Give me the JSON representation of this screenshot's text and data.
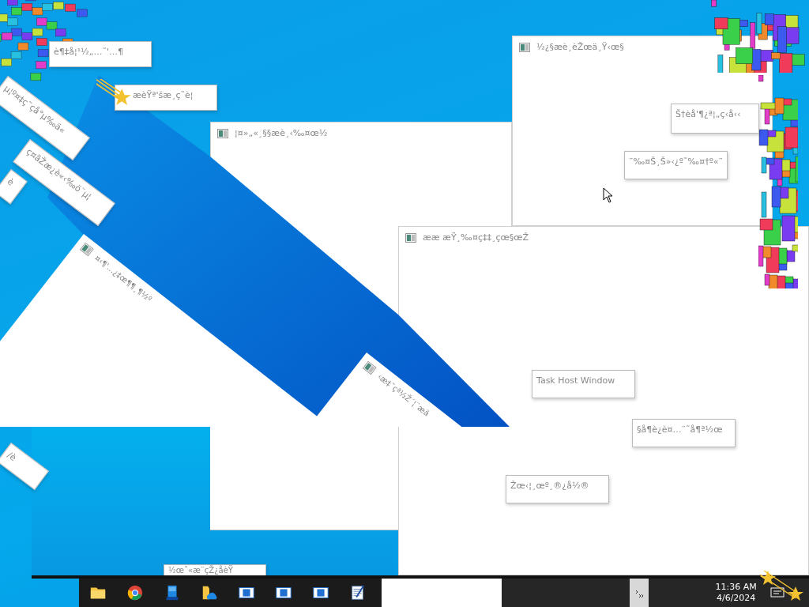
{
  "windows": [
    {
      "title": "¦¤»„«¸§§æè¸‹‰¤œ½"
    },
    {
      "title": "½¿§æè¸èŽœä¸Ÿ‹œ§"
    },
    {
      "title": "ææ æŸ¸‰¤ç‡‡¸çœ§œŽ"
    },
    {
      "title": "¤‹¶'…¿‡œ¶¶¸¶½º"
    },
    {
      "title": "‹æ‡˜çª½Ž´¦¨æä"
    }
  ],
  "floating_labels": [
    {
      "text": "è¶‡å¦¹½„…˜'…¶"
    },
    {
      "text": "æèŸª'šæ¸ç˜è¦"
    },
    {
      "text": "µ¦º¤‡ç˜çå°µ‰ä«"
    },
    {
      "text": "ç¤ãŽæ¿è«‹‰ö¨µ¦"
    },
    {
      "text": "è"
    },
    {
      "text": "Š†èå'¶¿ª¦„ç‹å‹‹"
    },
    {
      "text": "¨‰¤Š¸Š»‹¿º˜‰¤†º«¨"
    },
    {
      "text": "Task Host Window"
    },
    {
      "text": "§å¶è¿è¤…¨˜å¶ª½œ"
    },
    {
      "text": "Žœ‹¦¸œº¸®¿å½®"
    },
    {
      "text": "½œ˜«æ¨çŽ¿åèŸ"
    },
    {
      "text": "/è"
    }
  ],
  "taskbar": {
    "clock": {
      "time": "11:36 AM",
      "date": "4/6/2024"
    }
  }
}
